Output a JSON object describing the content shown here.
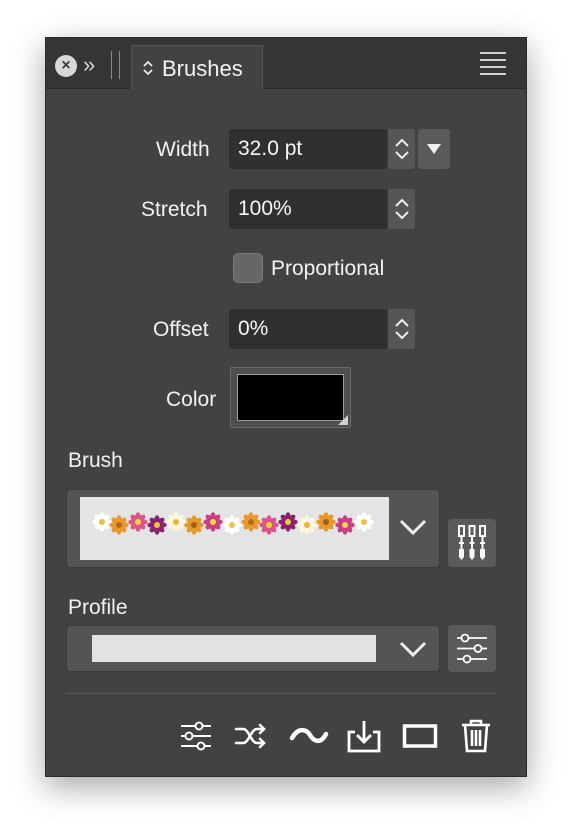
{
  "tab": {
    "label": "Brushes"
  },
  "width": {
    "label": "Width",
    "value": "32.0 pt"
  },
  "stretch": {
    "label": "Stretch",
    "value": "100%"
  },
  "proportional": {
    "label": "Proportional",
    "checked": false
  },
  "offset": {
    "label": "Offset",
    "value": "0%"
  },
  "color": {
    "label": "Color",
    "value": "#000000"
  },
  "brush": {
    "label": "Brush"
  },
  "profile": {
    "label": "Profile"
  },
  "icons": {
    "close": "close-icon",
    "collapse": "double-chevron-right-icon",
    "tab": "up-down-chevron-icon",
    "menu": "hamburger-menu-icon",
    "brush_side": "brushes-icon",
    "profile_side": "sliders-icon",
    "toolbar": [
      "sliders-icon",
      "shuffle-icon",
      "stroke-wave-icon",
      "import-icon",
      "rectangle-icon",
      "trash-icon"
    ]
  }
}
